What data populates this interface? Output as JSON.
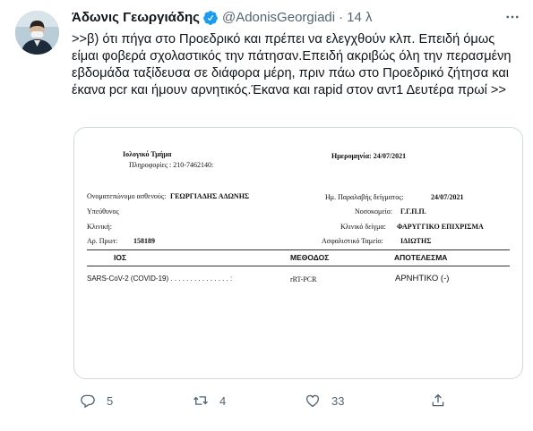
{
  "author": {
    "name": "Άδωνις Γεωργιάδης",
    "handle": "@AdonisGeorgiadi",
    "separator": "·",
    "time": "14 λ"
  },
  "tweet_text": ">>β) ότι πήγα στο Προεδρικό και πρέπει να ελεγχθούν κλπ. Επειδή όμως είμαι φοβερά σχολαστικός την πάτησαν.Επειδή ακριβώς όλη την περασμένη εβδομάδα ταξίδευσα σε διάφορα μέρη, πριν πάω στο Προεδρικό ζήτησα και έκανα pcr και ήμουν αρνητικός.Έκανα και rapid στον αντ1 Δευτέρα πρωί >>",
  "document": {
    "dept": "Ιολογικό Τμήμα",
    "info": "Πληροφορίες : 210-7462140:",
    "date_label": "Ημερομηνία: 24/07/2021",
    "patient_label": "Ονοματεπώνυμο ασθενούς:",
    "patient_value": "ΓΕΩΡΓΙΑΔΗΣ ΑΔΩΝΗΣ",
    "responsible_label": "Υπεύθυνος",
    "clinic_label": "Κλινική:",
    "protocol_label": "Αρ. Πρωτ:",
    "protocol_value": "158189",
    "received_label": "Ημ. Παραλαβής δείγματος:",
    "received_value": "24/07/2021",
    "hospital_label": "Νοσοκομείο:",
    "hospital_value": "Γ.Γ.Π.Π.",
    "sample_label": "Κλινικό δείγμα:",
    "sample_value": "ΦΑΡΥΓΓΙΚΟ ΕΠΙΧΡΙΣΜΑ",
    "insurance_label": "Ασφαλιστικό Ταμείο:",
    "insurance_value": "ΙΔΙΩΤΗΣ",
    "col_virus": "ΙΟΣ",
    "col_method": "ΜΕΘΟΔΟΣ",
    "col_result": "ΑΠΟΤΕΛΕΣΜΑ",
    "row_virus": "SARS-CoV-2 (COVID-19) . . . . . . . . . . . . . . . :",
    "row_method": "rRT-PCR",
    "row_result": "ΑΡΝΗΤΙΚΟ (-)"
  },
  "actions": {
    "replies": "5",
    "retweets": "4",
    "likes": "33"
  },
  "icons": [
    "verified-icon",
    "more-icon",
    "reply-icon",
    "retweet-icon",
    "like-icon",
    "share-icon"
  ],
  "colors": {
    "verified": "#1d9bf0",
    "secondary": "#536471",
    "text": "#0f1419",
    "border": "#cfd9de"
  }
}
